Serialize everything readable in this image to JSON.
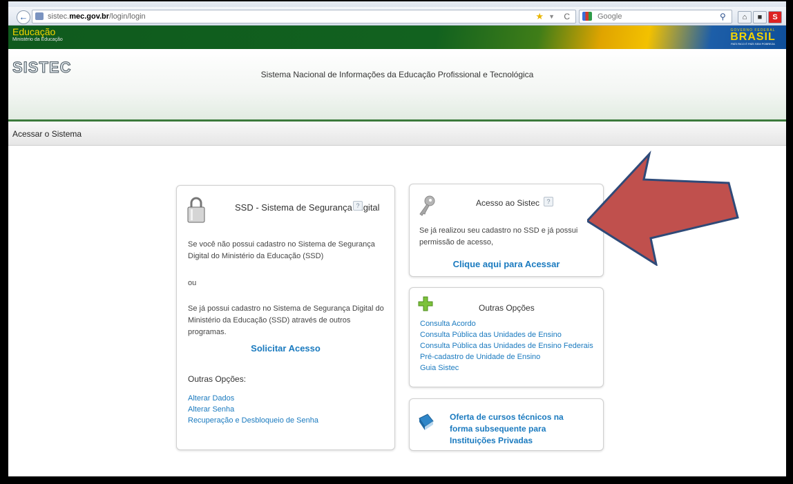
{
  "browser": {
    "url_host": "sistec.",
    "url_domain": "mec.gov.br",
    "url_path": "/login/login",
    "search_placeholder": "Google",
    "reload_glyph": "C",
    "s_button": "S"
  },
  "gov_banner": {
    "title": "Educação",
    "subtitle": "Ministério da Educação",
    "brasil_word": "BRASIL",
    "brasil_top": "GOVERNO FEDERAL",
    "brasil_bottom": "PAÍS RICO É PAÍS SEM POBREZA"
  },
  "header": {
    "logo": "SISTEC",
    "title": "Sistema Nacional de Informações da Educação Profissional e Tecnológica"
  },
  "breadcrumb": "Acessar o Sistema",
  "ssd_panel": {
    "title": "SSD - Sistema de Segurança Digital",
    "help": "?",
    "paragraph1": "Se você não possui cadastro no Sistema de Segurança Digital do Ministério da Educação (SSD)",
    "ou": "ou",
    "paragraph2": "Se já possui cadastro no Sistema de Segurança Digital do Ministério da Educação (SSD) através de outros programas.",
    "solicitar": "Solicitar Acesso",
    "outras_title": "Outras Opções:",
    "links": [
      "Alterar Dados",
      "Alterar Senha",
      "Recuperação e Desbloqueio de Senha"
    ]
  },
  "acesso_panel": {
    "title": "Acesso ao Sistec",
    "help": "?",
    "paragraph": "Se já realizou seu cadastro no SSD e já possui permissão de acesso,",
    "link": "Clique aqui para Acessar"
  },
  "outras_panel": {
    "title": "Outras Opções",
    "links": [
      "Consulta Acordo",
      "Consulta Pública das Unidades de Ensino",
      "Consulta Pública das Unidades de Ensino Federais",
      "Pré-cadastro de Unidade de Ensino",
      "Guia Sistec"
    ]
  },
  "oferta_panel": {
    "link": "Oferta de cursos técnicos na forma subsequente para Instituições Privadas"
  },
  "colors": {
    "link": "#1a7abf",
    "gov_green": "#12621f",
    "arrow_fill": "#c0504d",
    "arrow_stroke": "#2f4a78"
  }
}
